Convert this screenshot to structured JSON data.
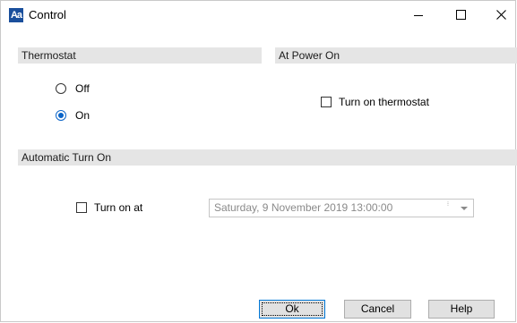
{
  "window": {
    "title": "Control",
    "icon": "app-icon",
    "icon_text": "Aa",
    "controls": {
      "minimize": "—",
      "maximize": "☐",
      "close": "✕"
    }
  },
  "thermostat": {
    "header": "Thermostat",
    "options": [
      {
        "label": "Off",
        "checked": false
      },
      {
        "label": "On",
        "checked": true
      }
    ]
  },
  "power_on": {
    "header": "At Power On",
    "checkbox_label": "Turn on thermostat",
    "checked": false
  },
  "auto_turn_on": {
    "header": "Automatic Turn On",
    "checkbox_label": "Turn on at",
    "checked": false,
    "datetime_value": "Saturday, 9 November 2019  13:00:00"
  },
  "buttons": {
    "ok": "Ok",
    "cancel": "Cancel",
    "help": "Help"
  },
  "colors": {
    "accent": "#0a64c8",
    "header_bg": "#e5e5e5",
    "button_bg": "#e1e1e1"
  }
}
